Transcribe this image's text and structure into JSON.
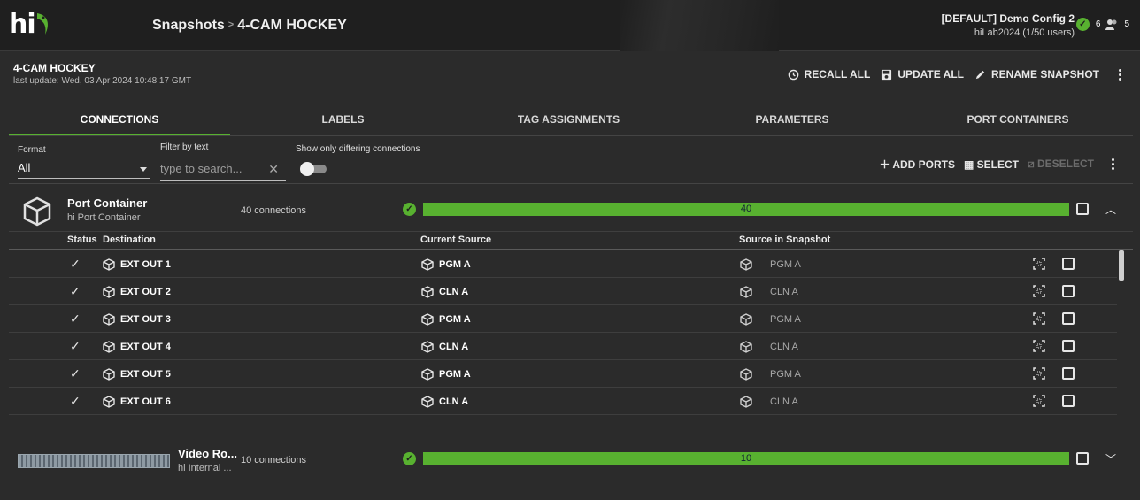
{
  "topbar": {
    "logo": "hi",
    "breadcrumb_root": "Snapshots",
    "breadcrumb_sep": ">",
    "breadcrumb_current": "4-CAM HOCKEY",
    "config_name": "[DEFAULT] Demo Config 2",
    "config_user": "hiLab2024 (1/50 users)",
    "status_ok_count": "6",
    "users_count": "5"
  },
  "snapshot": {
    "title": "4-CAM HOCKEY",
    "last_update": "last update: Wed, 03 Apr 2024 10:48:17 GMT",
    "actions": {
      "recall_all": "RECALL ALL",
      "update_all": "UPDATE ALL",
      "rename": "RENAME SNAPSHOT"
    }
  },
  "tabs": [
    "CONNECTIONS",
    "LABELS",
    "TAG ASSIGNMENTS",
    "PARAMETERS",
    "PORT CONTAINERS"
  ],
  "filters": {
    "format_label": "Format",
    "format_value": "All",
    "filter_label": "Filter by text",
    "filter_placeholder": "type to search...",
    "differing_label": "Show only differing connections",
    "add_ports": "ADD PORTS",
    "select": "SELECT",
    "deselect": "DESELECT"
  },
  "port_container": {
    "name": "Port Container",
    "subtitle": "hi Port Container",
    "connections": "40 connections",
    "progress_value": "40",
    "progress_fraction": 1.0
  },
  "table": {
    "headers": {
      "status": "Status",
      "destination": "Destination",
      "current_source": "Current Source",
      "snapshot_source": "Source in Snapshot"
    },
    "rows": [
      {
        "dest": "EXT OUT 1",
        "current": "PGM A",
        "snapshot": "PGM A"
      },
      {
        "dest": "EXT OUT 2",
        "current": "CLN A",
        "snapshot": "CLN A"
      },
      {
        "dest": "EXT OUT 3",
        "current": "PGM A",
        "snapshot": "PGM A"
      },
      {
        "dest": "EXT OUT 4",
        "current": "CLN A",
        "snapshot": "CLN A"
      },
      {
        "dest": "EXT OUT 5",
        "current": "PGM A",
        "snapshot": "PGM A"
      },
      {
        "dest": "EXT OUT 6",
        "current": "CLN A",
        "snapshot": "CLN A"
      }
    ]
  },
  "video_router": {
    "name": "Video Ro...",
    "subtitle": "hi Internal ...",
    "connections": "10 connections",
    "progress_value": "10",
    "progress_fraction": 1.0
  },
  "colors": {
    "accent": "#58b130",
    "background": "#2b2b2b",
    "topbar": "#1f1f1f"
  }
}
